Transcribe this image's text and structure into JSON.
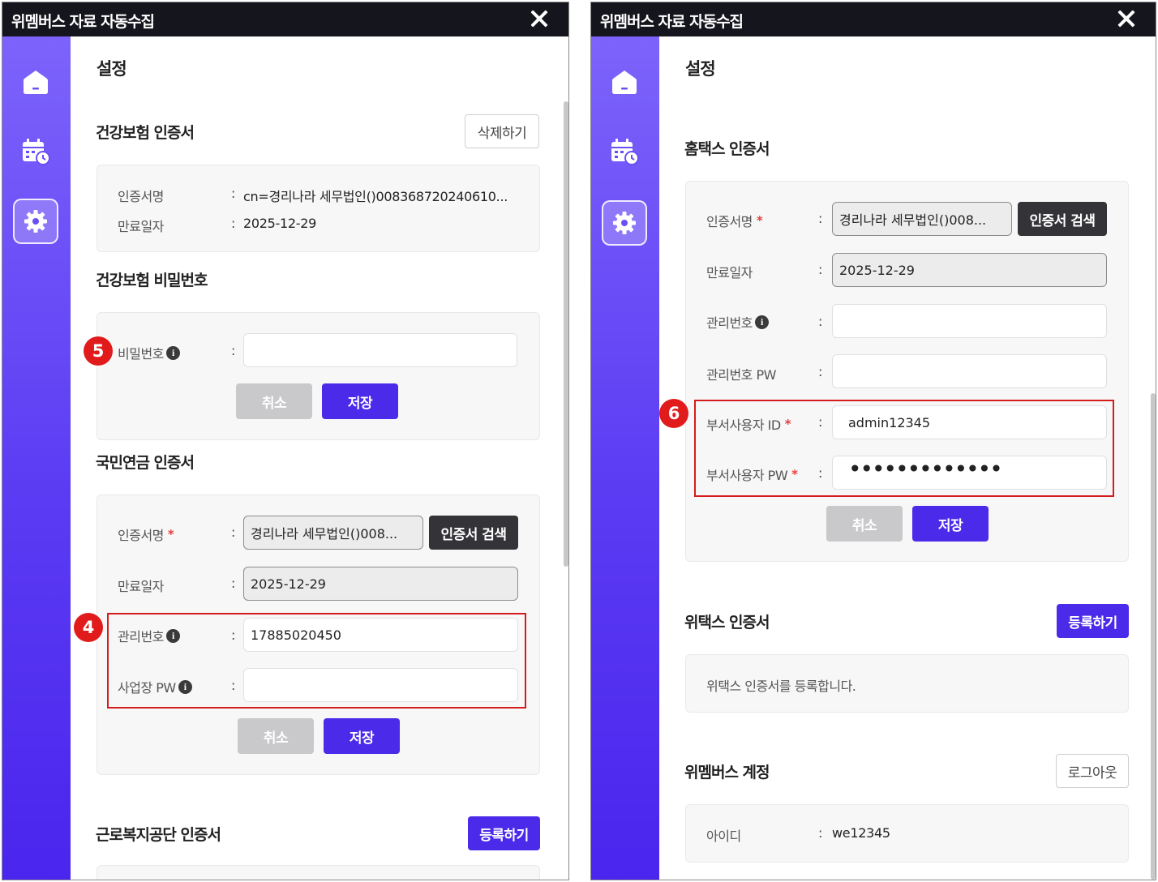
{
  "app": {
    "title": "위멤버스 자료 자동수집"
  },
  "nav": [
    {
      "name": "home-icon"
    },
    {
      "name": "calendar-icon"
    },
    {
      "name": "gear-icon"
    }
  ],
  "left": {
    "page_title": "설정",
    "health_cert": {
      "title": "건강보험 인증서",
      "delete_button": "삭제하기",
      "cert_name_label": "인증서명",
      "cert_name_value": "cn=경리나라 세무법인()008368720240610...",
      "expiry_label": "만료일자",
      "expiry_value": "2025-12-29"
    },
    "health_pw": {
      "title": "건강보험 비밀번호",
      "password_label": "비밀번호",
      "password_value": "",
      "cancel": "취소",
      "save": "저장"
    },
    "pension_cert": {
      "title": "국민연금 인증서",
      "cert_name_label": "인증서명",
      "cert_name_value": "경리나라 세무법인()008...",
      "search_button": "인증서 검색",
      "expiry_label": "만료일자",
      "expiry_value": "2025-12-29",
      "mgmt_no_label": "관리번호",
      "mgmt_no_value": "17885020450",
      "biz_pw_label": "사업장 PW",
      "biz_pw_value": "",
      "cancel": "취소",
      "save": "저장"
    },
    "welfare_cert": {
      "title": "근로복지공단 인증서",
      "register_button": "등록하기"
    },
    "badges": {
      "health_pw": "5",
      "pension": "4"
    }
  },
  "right": {
    "page_title": "설정",
    "hometax": {
      "title": "홈택스 인증서",
      "cert_name_label": "인증서명",
      "cert_name_value": "경리나라 세무법인()008...",
      "search_button": "인증서 검색",
      "expiry_label": "만료일자",
      "expiry_value": "2025-12-29",
      "mgmt_no_label": "관리번호",
      "mgmt_no_value": "",
      "mgmt_pw_label": "관리번호 PW",
      "mgmt_pw_value": "",
      "dept_id_label": "부서사용자 ID",
      "dept_id_value": "admin12345",
      "dept_pw_label": "부서사용자 PW",
      "dept_pw_value": "•••••••••••••",
      "cancel": "취소",
      "save": "저장"
    },
    "wetax": {
      "title": "위택스 인증서",
      "register_button": "등록하기",
      "message": "위택스 인증서를 등록합니다."
    },
    "account": {
      "title": "위멤버스 계정",
      "logout_button": "로그아웃",
      "id_label": "아이디",
      "id_value": "we12345"
    },
    "badges": {
      "hometax": "6"
    }
  },
  "colors": {
    "accent": "#4b2be9",
    "sidebar_top": "#7d63fb",
    "sidebar_bottom": "#4a25ee",
    "highlight": "#d41c1c",
    "titlebar": "#15151d"
  }
}
